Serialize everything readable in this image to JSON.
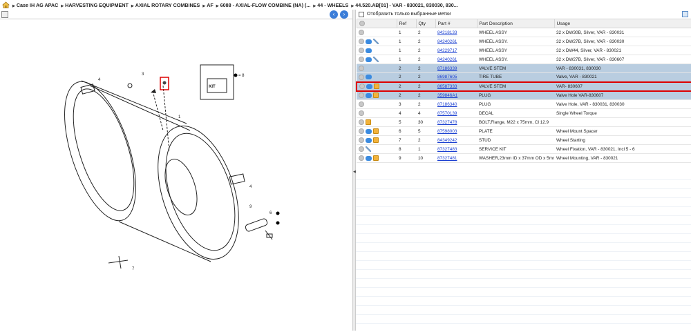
{
  "breadcrumb": {
    "items": [
      "Case IH AG APAC",
      "HARVESTING EQUIPMENT",
      "AXIAL ROTARY COMBINES",
      "AF",
      "6088 - AXIAL-FLOW COMBINE (NA) (...",
      "44 - WHEELS",
      "44.520.AB[01] - VAR - 830021, 830030, 830..."
    ]
  },
  "diagram": {
    "callouts": [
      "1",
      "3",
      "4",
      "4",
      "6",
      "7",
      "8",
      "9"
    ],
    "kit_label": "= 8",
    "kit_text": "KIT"
  },
  "filter": {
    "label": "Отобразить только выбранные метки"
  },
  "table": {
    "headers": {
      "ref": "Ref",
      "qty": "Qty",
      "part": "Part #",
      "desc": "Part Description",
      "usage": "Usage"
    },
    "rows": [
      {
        "ref": "1",
        "qty": "2",
        "part": "84218133",
        "desc": "WHEEL ASSY",
        "usage": "32 x DW30B, Silver, VAR - 830031",
        "icons": [
          "circle"
        ]
      },
      {
        "ref": "1",
        "qty": "2",
        "part": "84240261",
        "desc": "WHEEL ASSY.",
        "usage": "32 x DW27B, Silver, VAR - 830030",
        "icons": [
          "circle",
          "blue",
          "tool"
        ]
      },
      {
        "ref": "1",
        "qty": "2",
        "part": "84229717",
        "desc": "WHEEL ASSY",
        "usage": "32 x DW44, Silver, VAR - 830021",
        "icons": [
          "circle",
          "blue"
        ]
      },
      {
        "ref": "1",
        "qty": "2",
        "part": "84240261",
        "desc": "WHEEL ASSY.",
        "usage": "32 x DW27B, Silver, VAR - 830607",
        "icons": [
          "circle",
          "blue",
          "tool"
        ]
      },
      {
        "ref": "2",
        "qty": "2",
        "part": "87186339",
        "desc": "VALVE STEM",
        "usage": "VAR - 830031, 830030",
        "icons": [
          "circle"
        ],
        "selected": true
      },
      {
        "ref": "2",
        "qty": "2",
        "part": "86987605",
        "desc": "TIRE TUBE",
        "usage": "Valve, VAR - 830021",
        "icons": [
          "circle",
          "blue"
        ],
        "selected": true
      },
      {
        "ref": "2",
        "qty": "2",
        "part": "86587333",
        "desc": "VALVE STEM",
        "usage": "VAR- 830607",
        "icons": [
          "circle",
          "blue",
          "box"
        ],
        "selected": true,
        "highlight": true
      },
      {
        "ref": "2",
        "qty": "2",
        "part": "359846A1",
        "desc": "PLUG",
        "usage": "Valve Hole VAR-830607",
        "icons": [
          "circle",
          "blue",
          "box"
        ],
        "selected": true
      },
      {
        "ref": "3",
        "qty": "2",
        "part": "87186340",
        "desc": "PLUG",
        "usage": "Valve Hole, VAR - 830031, 830030",
        "icons": [
          "circle"
        ]
      },
      {
        "ref": "4",
        "qty": "4",
        "part": "87570139",
        "desc": "DECAL",
        "usage": "Single Wheel Torque",
        "icons": [
          "circle"
        ]
      },
      {
        "ref": "5",
        "qty": "30",
        "part": "87327478",
        "desc": "BOLT,Flange, M22 x 75mm, Cl 12.9",
        "usage": "",
        "icons": [
          "circle",
          "box"
        ]
      },
      {
        "ref": "6",
        "qty": "5",
        "part": "87598003",
        "desc": "PLATE",
        "usage": "Wheel Mount Spacer",
        "icons": [
          "circle",
          "blue",
          "box"
        ]
      },
      {
        "ref": "7",
        "qty": "2",
        "part": "84349242",
        "desc": "STUD",
        "usage": "Wheel Starting",
        "icons": [
          "circle",
          "blue",
          "box"
        ]
      },
      {
        "ref": "8",
        "qty": "1",
        "part": "87327483",
        "desc": "SERVICE KIT",
        "usage": "Wheel Fixation, VAR - 830021, Incl 5 - 6",
        "icons": [
          "circle",
          "tool"
        ]
      },
      {
        "ref": "9",
        "qty": "10",
        "part": "87327481",
        "desc": "WASHER,23mm ID x 37mm OD x 5mm Thk",
        "usage": "Wheel Mounting, VAR - 830021",
        "icons": [
          "circle",
          "blue",
          "box"
        ]
      }
    ]
  }
}
